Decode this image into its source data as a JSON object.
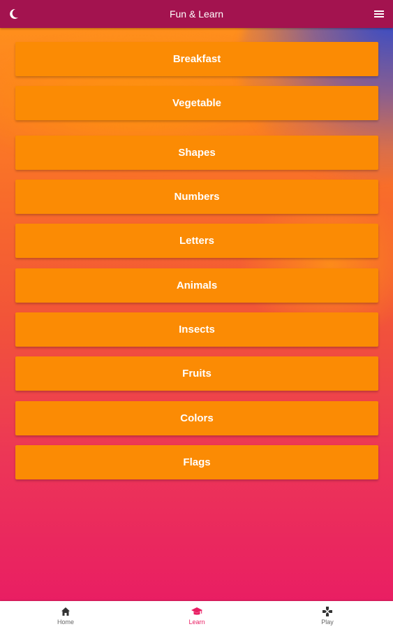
{
  "appbar": {
    "title": "Fun & Learn",
    "left_icon": "moon-icon",
    "right_icon": "menu-icon"
  },
  "categories": [
    {
      "label": "Breakfast"
    },
    {
      "label": "Vegetable"
    },
    {
      "label": "Shapes"
    },
    {
      "label": "Numbers"
    },
    {
      "label": "Letters"
    },
    {
      "label": "Animals"
    },
    {
      "label": "Insects"
    },
    {
      "label": "Fruits"
    },
    {
      "label": "Colors"
    },
    {
      "label": "Flags"
    }
  ],
  "bottom_nav": {
    "items": [
      {
        "label": "Home",
        "icon": "home-icon",
        "active": false
      },
      {
        "label": "Learn",
        "icon": "graduation-cap-icon",
        "active": true
      },
      {
        "label": "Play",
        "icon": "gamepad-icon",
        "active": false
      }
    ]
  },
  "colors": {
    "appbar": "#a3134f",
    "button": "#fb8b04",
    "active_tab": "#e91e63",
    "gradient_top": "#ff8f1c",
    "gradient_bottom": "#e91e63"
  }
}
